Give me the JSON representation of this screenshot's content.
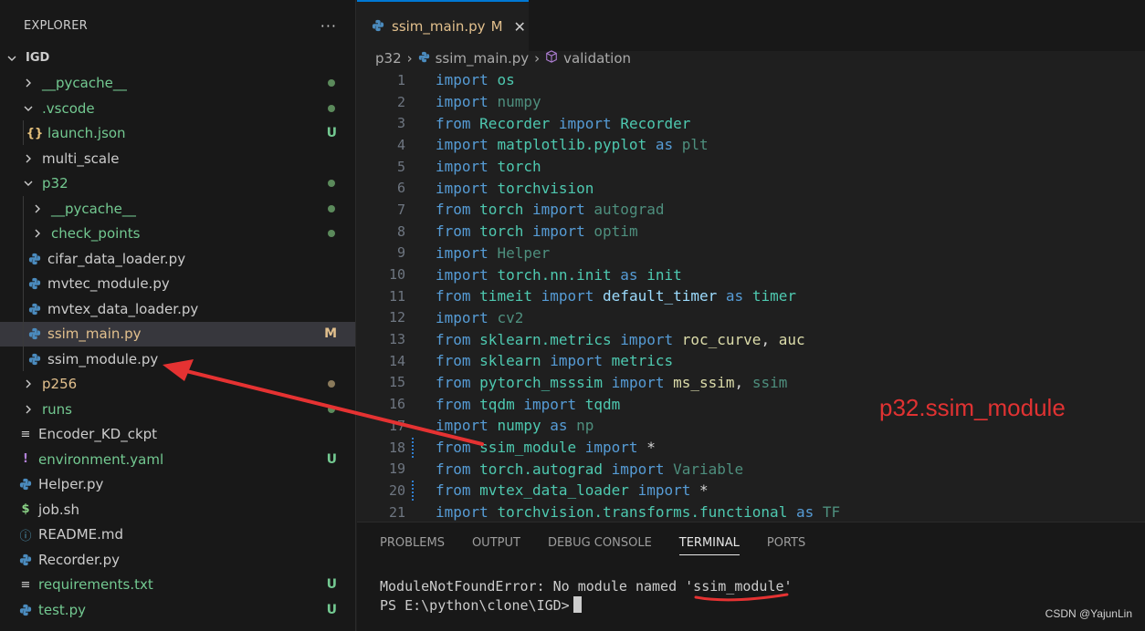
{
  "sidebar": {
    "title": "EXPLORER",
    "more": "···",
    "root": "IGD",
    "items": [
      {
        "label": "__pycache__",
        "kind": "folder",
        "state": "collapsed",
        "indent": 1,
        "color": "#73c991",
        "decoration": "dot"
      },
      {
        "label": ".vscode",
        "kind": "folder",
        "state": "expanded",
        "indent": 1,
        "color": "#73c991",
        "decoration": "dot"
      },
      {
        "label": "launch.json",
        "kind": "json",
        "indent": 2,
        "color": "#73c991",
        "decoration": "U"
      },
      {
        "label": "multi_scale",
        "kind": "folder",
        "state": "collapsed",
        "indent": 1,
        "color": "#cccccc",
        "decoration": ""
      },
      {
        "label": "p32",
        "kind": "folder",
        "state": "expanded",
        "indent": 1,
        "color": "#73c991",
        "decoration": "dot"
      },
      {
        "label": "__pycache__",
        "kind": "folder",
        "state": "collapsed",
        "indent": 2,
        "color": "#73c991",
        "decoration": "dot"
      },
      {
        "label": "check_points",
        "kind": "folder",
        "state": "collapsed",
        "indent": 2,
        "color": "#73c991",
        "decoration": "dot"
      },
      {
        "label": "cifar_data_loader.py",
        "kind": "python",
        "indent": 2,
        "color": "#cccccc",
        "decoration": ""
      },
      {
        "label": "mvtec_module.py",
        "kind": "python",
        "indent": 2,
        "color": "#cccccc",
        "decoration": ""
      },
      {
        "label": "mvtex_data_loader.py",
        "kind": "python",
        "indent": 2,
        "color": "#cccccc",
        "decoration": ""
      },
      {
        "label": "ssim_main.py",
        "kind": "python",
        "indent": 2,
        "color": "#e2c08d",
        "decoration": "M",
        "selected": true
      },
      {
        "label": "ssim_module.py",
        "kind": "python",
        "indent": 2,
        "color": "#cccccc",
        "decoration": ""
      },
      {
        "label": "p256",
        "kind": "folder",
        "state": "collapsed",
        "indent": 1,
        "color": "#e2c08d",
        "decoration": "dot-brown"
      },
      {
        "label": "runs",
        "kind": "folder",
        "state": "collapsed",
        "indent": 1,
        "color": "#73c991",
        "decoration": "dot"
      },
      {
        "label": "Encoder_KD_ckpt",
        "kind": "list",
        "indent": 1,
        "color": "#cccccc",
        "decoration": ""
      },
      {
        "label": "environment.yaml",
        "kind": "yaml",
        "indent": 1,
        "color": "#73c991",
        "decoration": "U"
      },
      {
        "label": "Helper.py",
        "kind": "python",
        "indent": 1,
        "color": "#cccccc",
        "decoration": ""
      },
      {
        "label": "job.sh",
        "kind": "shell",
        "indent": 1,
        "color": "#cccccc",
        "decoration": ""
      },
      {
        "label": "README.md",
        "kind": "info",
        "indent": 1,
        "color": "#cccccc",
        "decoration": ""
      },
      {
        "label": "Recorder.py",
        "kind": "python",
        "indent": 1,
        "color": "#cccccc",
        "decoration": ""
      },
      {
        "label": "requirements.txt",
        "kind": "list",
        "indent": 1,
        "color": "#73c991",
        "decoration": "U"
      },
      {
        "label": "test.py",
        "kind": "python",
        "indent": 1,
        "color": "#73c991",
        "decoration": "U"
      }
    ]
  },
  "editor": {
    "tab": {
      "title": "ssim_main.py",
      "status": "M",
      "close": "✕"
    },
    "breadcrumb": [
      "p32",
      "ssim_main.py",
      "validation"
    ],
    "lines": [
      {
        "n": "1",
        "t": [
          [
            "kw",
            "import "
          ],
          [
            "mod",
            "os"
          ]
        ]
      },
      {
        "n": "2",
        "t": [
          [
            "kw",
            "import "
          ],
          [
            "dim",
            "numpy"
          ]
        ]
      },
      {
        "n": "3",
        "t": [
          [
            "kw",
            "from "
          ],
          [
            "mod",
            "Recorder "
          ],
          [
            "kw",
            "import "
          ],
          [
            "mod",
            "Recorder"
          ]
        ]
      },
      {
        "n": "4",
        "t": [
          [
            "kw",
            "import "
          ],
          [
            "mod",
            "matplotlib.pyplot "
          ],
          [
            "kw",
            "as "
          ],
          [
            "dim",
            "plt"
          ]
        ]
      },
      {
        "n": "5",
        "t": [
          [
            "kw",
            "import "
          ],
          [
            "mod",
            "torch"
          ]
        ]
      },
      {
        "n": "6",
        "t": [
          [
            "kw",
            "import "
          ],
          [
            "mod",
            "torchvision"
          ]
        ]
      },
      {
        "n": "7",
        "t": [
          [
            "kw",
            "from "
          ],
          [
            "mod",
            "torch "
          ],
          [
            "kw",
            "import "
          ],
          [
            "dim",
            "autograd"
          ]
        ]
      },
      {
        "n": "8",
        "t": [
          [
            "kw",
            "from "
          ],
          [
            "mod",
            "torch "
          ],
          [
            "kw",
            "import "
          ],
          [
            "dim",
            "optim"
          ]
        ]
      },
      {
        "n": "9",
        "t": [
          [
            "kw",
            "import "
          ],
          [
            "dim",
            "Helper"
          ]
        ]
      },
      {
        "n": "10",
        "t": [
          [
            "kw",
            "import "
          ],
          [
            "mod",
            "torch.nn.init "
          ],
          [
            "kw",
            "as "
          ],
          [
            "mod",
            "init"
          ]
        ]
      },
      {
        "n": "11",
        "t": [
          [
            "kw",
            "from "
          ],
          [
            "mod",
            "timeit "
          ],
          [
            "kw",
            "import "
          ],
          [
            "var",
            "default_timer "
          ],
          [
            "kw",
            "as "
          ],
          [
            "mod",
            "timer"
          ]
        ]
      },
      {
        "n": "12",
        "t": [
          [
            "kw",
            "import "
          ],
          [
            "dim",
            "cv2"
          ]
        ]
      },
      {
        "n": "13",
        "t": [
          [
            "kw",
            "from "
          ],
          [
            "mod",
            "sklearn.metrics "
          ],
          [
            "kw",
            "import "
          ],
          [
            "fn",
            "roc_curve"
          ],
          [
            "op",
            ", "
          ],
          [
            "fn",
            "auc"
          ]
        ]
      },
      {
        "n": "14",
        "t": [
          [
            "kw",
            "from "
          ],
          [
            "mod",
            "sklearn "
          ],
          [
            "kw",
            "import "
          ],
          [
            "mod",
            "metrics"
          ]
        ]
      },
      {
        "n": "15",
        "t": [
          [
            "kw",
            "from "
          ],
          [
            "mod",
            "pytorch_msssim "
          ],
          [
            "kw",
            "import "
          ],
          [
            "fn",
            "ms_ssim"
          ],
          [
            "op",
            ", "
          ],
          [
            "dim",
            "ssim"
          ]
        ]
      },
      {
        "n": "16",
        "t": [
          [
            "kw",
            "from "
          ],
          [
            "mod",
            "tqdm "
          ],
          [
            "kw",
            "import "
          ],
          [
            "mod",
            "tqdm"
          ]
        ]
      },
      {
        "n": "17",
        "t": [
          [
            "kw",
            "import "
          ],
          [
            "mod",
            "numpy "
          ],
          [
            "kw",
            "as "
          ],
          [
            "dim",
            "np"
          ]
        ]
      },
      {
        "n": "18",
        "t": [
          [
            "kw",
            "from "
          ],
          [
            "mod",
            "ssim_module "
          ],
          [
            "kw",
            "import "
          ],
          [
            "op",
            "*"
          ]
        ],
        "mark": true
      },
      {
        "n": "19",
        "t": [
          [
            "kw",
            "from "
          ],
          [
            "mod",
            "torch.autograd "
          ],
          [
            "kw",
            "import "
          ],
          [
            "dim",
            "Variable"
          ]
        ]
      },
      {
        "n": "20",
        "t": [
          [
            "kw",
            "from "
          ],
          [
            "mod",
            "mvtex_data_loader "
          ],
          [
            "kw",
            "import "
          ],
          [
            "op",
            "*"
          ]
        ],
        "mark": true
      },
      {
        "n": "21",
        "t": [
          [
            "kw",
            "import "
          ],
          [
            "mod",
            "torchvision.transforms.functional "
          ],
          [
            "kw",
            "as "
          ],
          [
            "dim",
            "TF"
          ]
        ]
      }
    ]
  },
  "annotation": "p32.ssim_module",
  "panel": {
    "tabs": [
      "PROBLEMS",
      "OUTPUT",
      "DEBUG CONSOLE",
      "TERMINAL",
      "PORTS"
    ],
    "active_tab": "TERMINAL",
    "terminal": {
      "error_prefix": "ModuleNotFoundError: No module named '",
      "error_module": "ssim_module",
      "error_suffix": "'",
      "prompt": "PS E:\\python\\clone\\IGD>"
    }
  },
  "watermark": "CSDN @YajunLin",
  "colors": {
    "accent": "#0078d4",
    "annotation": "#e03232"
  }
}
